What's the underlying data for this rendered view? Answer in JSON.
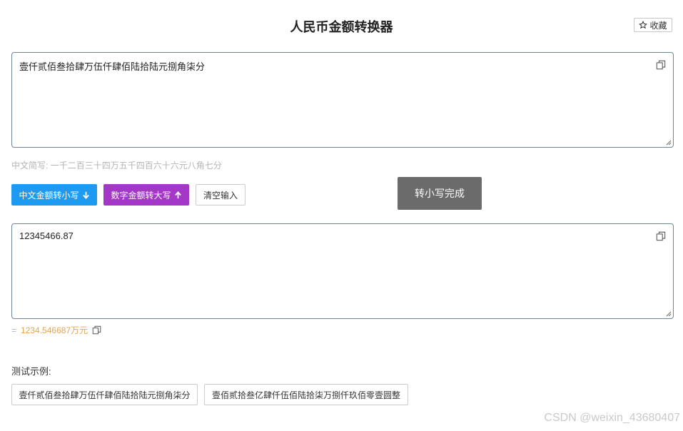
{
  "header": {
    "title": "人民币金额转换器",
    "favorite_label": "收藏"
  },
  "chinese_input": {
    "value": "壹仟贰佰叁拾肆万伍仟肆佰陆拾陆元捌角柒分"
  },
  "chinese_simple": {
    "label": "中文简写:",
    "value": "一千二百三十四万五千四百六十六元八角七分"
  },
  "actions": {
    "to_lower_label": "中文金额转小写",
    "to_upper_label": "数字金额转大写",
    "clear_label": "清空输入"
  },
  "toast": {
    "message": "转小写完成"
  },
  "number_input": {
    "value": "12345466.87"
  },
  "result": {
    "prefix": "=",
    "value": "1234.546687万元"
  },
  "examples": {
    "label": "测试示例:",
    "items": [
      "壹仟贰佰叁拾肆万伍仟肆佰陆拾陆元捌角柒分",
      "壹佰贰拾叁亿肆仟伍佰陆拾柒万捌仟玖佰零壹圆整"
    ]
  },
  "watermark": "CSDN @weixin_43680407",
  "colors": {
    "blue_button": "#1e9bf0",
    "purple_button": "#a436c8",
    "result_text": "#e0a654",
    "toast_bg": "#6b6b6b"
  }
}
